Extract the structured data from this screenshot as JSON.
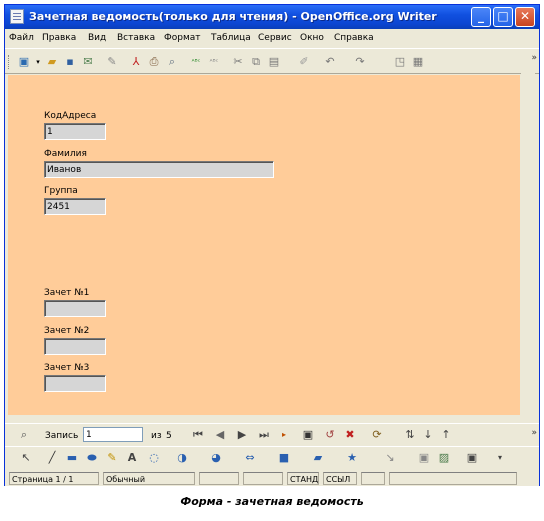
{
  "window": {
    "title": "Зачетная ведомость(только для чтения) - OpenOffice.org Writer"
  },
  "menu": [
    "Файл",
    "Правка",
    "Вид",
    "Вставка",
    "Формат",
    "Таблица",
    "Сервис",
    "Окно",
    "Справка"
  ],
  "form": {
    "fields": [
      {
        "label": "КодАдреса",
        "value": "1"
      },
      {
        "label": "Фамилия",
        "value": "Иванов"
      },
      {
        "label": "Группа",
        "value": "2451"
      },
      {
        "label": "Зачет №1",
        "value": ""
      },
      {
        "label": "Зачет №2",
        "value": ""
      },
      {
        "label": "Зачет №3",
        "value": ""
      }
    ]
  },
  "navigation": {
    "record_label": "Запись",
    "record_value": "1",
    "of_label": "из",
    "total": "5"
  },
  "status": {
    "page": "Страница  1 / 1",
    "style": "Обычный",
    "mode1": "СТАНД",
    "mode2": "ССЫЛ"
  },
  "caption": "Форма - зачетная ведомость"
}
